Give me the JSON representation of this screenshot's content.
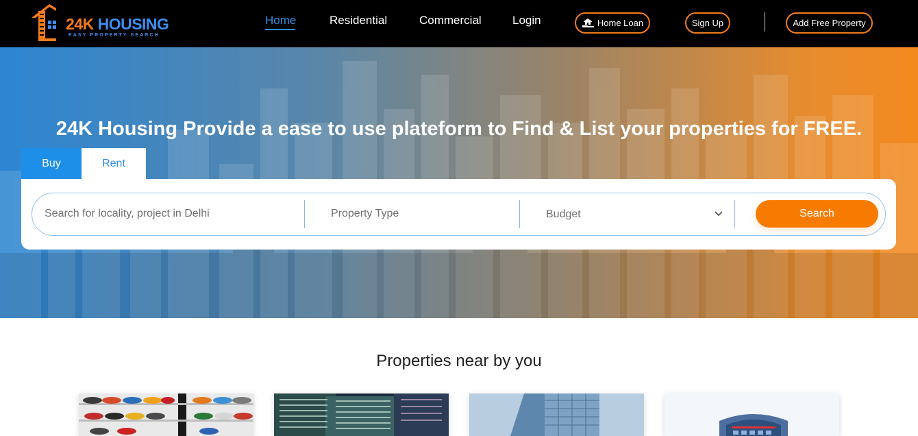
{
  "header": {
    "logo": {
      "name": "24K HOUSING",
      "tagline": "EASY PROPERTY SEARCH"
    },
    "nav": [
      {
        "label": "Home",
        "active": true
      },
      {
        "label": "Residential",
        "active": false
      },
      {
        "label": "Commercial",
        "active": false
      },
      {
        "label": "Login",
        "active": false
      }
    ],
    "home_loan_label": "Home Loan",
    "sign_up_label": "Sign Up",
    "add_property_label": "Add Free Property"
  },
  "hero": {
    "title": "24K Housing Provide a ease to use plateform to Find & List your properties for FREE.",
    "tabs": [
      {
        "label": "Buy",
        "active": true
      },
      {
        "label": "Rent",
        "active": false
      }
    ],
    "search": {
      "locality_placeholder": "Search for locality, project in Delhi",
      "property_type_placeholder": "Property Type",
      "budget_selected": "Budget",
      "button_label": "Search"
    }
  },
  "properties": {
    "title": "Properties near by you",
    "cards": [
      {
        "image": "sneaker-store-image"
      },
      {
        "image": "glass-tower-night-image"
      },
      {
        "image": "blue-tower-image"
      },
      {
        "image": "office-building-image"
      }
    ]
  },
  "colors": {
    "accent_orange": "#f77b00",
    "accent_blue": "#1e8fe8",
    "header_bg": "#000000"
  }
}
